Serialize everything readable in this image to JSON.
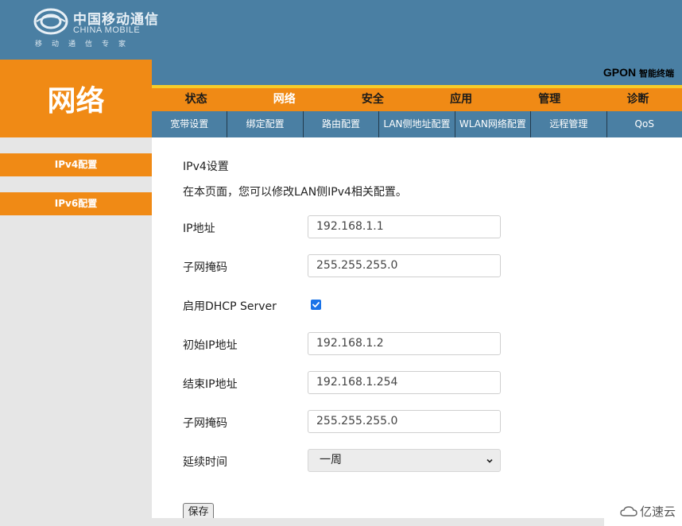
{
  "brand": {
    "name_cn": "中国移动通信",
    "name_en": "CHINA MOBILE",
    "slogan": "移动通信专家"
  },
  "section_title": "网络",
  "device": {
    "name": "GPON",
    "suffix": "智能终端"
  },
  "main_nav": {
    "tabs": [
      {
        "label": "状态"
      },
      {
        "label": "网络"
      },
      {
        "label": "安全"
      },
      {
        "label": "应用"
      },
      {
        "label": "管理"
      },
      {
        "label": "诊断"
      }
    ],
    "active": "网络"
  },
  "sub_nav": {
    "tabs": [
      {
        "label": "宽带设置"
      },
      {
        "label": "绑定配置"
      },
      {
        "label": "路由配置"
      },
      {
        "label": "LAN侧地址配置"
      },
      {
        "label": "WLAN网络配置"
      },
      {
        "label": "远程管理"
      },
      {
        "label": "QoS"
      }
    ],
    "active": "LAN侧地址配置"
  },
  "sidebar": {
    "items": [
      {
        "label": "IPv4配置"
      },
      {
        "label": "IPv6配置"
      }
    ]
  },
  "form": {
    "heading": "IPv4设置",
    "description": "在本页面，您可以修改LAN侧IPv4相关配置。",
    "ip_address": {
      "label": "IP地址",
      "value": "192.168.1.1"
    },
    "subnet_mask": {
      "label": "子网掩码",
      "value": "255.255.255.0"
    },
    "dhcp_enable": {
      "label": "启用DHCP Server",
      "checked": true
    },
    "start_ip": {
      "label": "初始IP地址",
      "value": "192.168.1.2"
    },
    "end_ip": {
      "label": "结束IP地址",
      "value": "192.168.1.254"
    },
    "dhcp_subnet_mask": {
      "label": "子网掩码",
      "value": "255.255.255.0"
    },
    "lease_time": {
      "label": "延续时间",
      "value": "一周"
    },
    "save_label": "保存"
  },
  "watermark": "亿速云",
  "colors": {
    "orange": "#f08a15",
    "blue_header": "#4a7fa3",
    "yellow_line": "#f5cc2a",
    "checkbox": "#1a73e8"
  }
}
